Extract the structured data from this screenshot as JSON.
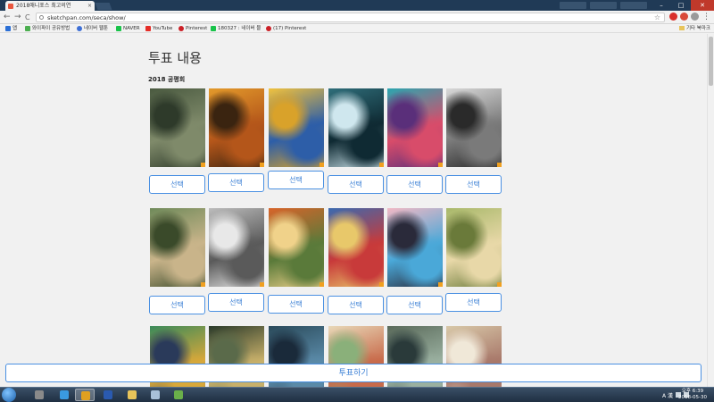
{
  "browser": {
    "tab_title": "2018애니포스 최고의연",
    "tab_close": "×",
    "url": "sketchpan.com/seca/show/",
    "nav_back": "←",
    "nav_forward": "→",
    "nav_reload": "C",
    "star": "☆",
    "menu": "⋮",
    "window_minimize": "–",
    "window_maximize": "□",
    "window_close": "✕"
  },
  "bookmarks": [
    {
      "label": "앱",
      "color": "#2b6fd6"
    },
    {
      "label": "와이파이 공유방법",
      "color": "#4caf50"
    },
    {
      "label": "네이버 웹툰",
      "color": "#3d6fd6"
    },
    {
      "label": "NAVER",
      "color": "#19c34a"
    },
    {
      "label": "YouTube",
      "color": "#e52d27"
    },
    {
      "label": "Pinterest",
      "color": "#cb2027"
    },
    {
      "label": "180327 : 네이버 블",
      "color": "#19c34a"
    },
    {
      "label": "(17) Pinterest",
      "color": "#cb2027"
    }
  ],
  "bookmarks_other": "기타 북마크",
  "page": {
    "title": "투표 내용",
    "subtitle": "2018 공평회",
    "select_label": "선택",
    "vote_button": "투표하기"
  },
  "artworks": [
    {
      "name": "artwork-1",
      "colors": [
        "#4a5a40",
        "#7f8a6a",
        "#2e3a2a"
      ]
    },
    {
      "name": "artwork-2",
      "colors": [
        "#e39a2b",
        "#b4561a",
        "#3a2410"
      ]
    },
    {
      "name": "artwork-3",
      "colors": [
        "#f2c23c",
        "#2d5ea8",
        "#d9a22a"
      ]
    },
    {
      "name": "artwork-4",
      "colors": [
        "#2f6e7a",
        "#0f2a33",
        "#cfe7ee"
      ]
    },
    {
      "name": "artwork-5",
      "colors": [
        "#2aa6b0",
        "#d84c6a",
        "#5a2f7a"
      ]
    },
    {
      "name": "artwork-6",
      "colors": [
        "#d8d8d8",
        "#7a7a7a",
        "#2a2a2a"
      ]
    },
    {
      "name": "artwork-7",
      "colors": [
        "#6f8a5a",
        "#c9b48a",
        "#3a4a2a"
      ]
    },
    {
      "name": "artwork-8",
      "colors": [
        "#bcbcbc",
        "#5a5a5a",
        "#e8e8e8"
      ]
    },
    {
      "name": "artwork-9",
      "colors": [
        "#d8642a",
        "#5a7a3a",
        "#f0d28a"
      ]
    },
    {
      "name": "artwork-10",
      "colors": [
        "#3a6ab0",
        "#c83a3a",
        "#e8c86a"
      ]
    },
    {
      "name": "artwork-11",
      "colors": [
        "#f2b8c4",
        "#4aa8d8",
        "#2a2a3a"
      ]
    },
    {
      "name": "artwork-12",
      "colors": [
        "#a8b86a",
        "#e8d8a8",
        "#6a7a3a"
      ]
    },
    {
      "name": "artwork-13",
      "colors": [
        "#3a8a5a",
        "#d8a83a",
        "#2a3a5a"
      ]
    },
    {
      "name": "artwork-14",
      "colors": [
        "#2a3a2a",
        "#c8b06a",
        "#5a6a4a"
      ]
    },
    {
      "name": "artwork-15",
      "colors": [
        "#2a4a5a",
        "#5a8aa8",
        "#1a2a3a"
      ]
    },
    {
      "name": "artwork-16",
      "colors": [
        "#e8d8b8",
        "#c86a4a",
        "#8ab07a"
      ]
    },
    {
      "name": "artwork-17",
      "colors": [
        "#5a6a5a",
        "#9ab0a0",
        "#2a3a3a"
      ]
    },
    {
      "name": "artwork-18",
      "colors": [
        "#d8c8a8",
        "#a8786a",
        "#f0e8d8"
      ]
    }
  ],
  "taskbar": {
    "apps": [
      {
        "name": "taskbar-app-1",
        "color": "#8a8a8a",
        "active": false
      },
      {
        "name": "taskbar-ie",
        "color": "#3a9ae0",
        "active": false
      },
      {
        "name": "taskbar-chrome",
        "color": "#e0a020",
        "active": true
      },
      {
        "name": "taskbar-photoshop",
        "color": "#2a5ab0",
        "active": false
      },
      {
        "name": "taskbar-explorer",
        "color": "#e8c45a",
        "active": false
      },
      {
        "name": "taskbar-app-6",
        "color": "#a8c0d8",
        "active": false
      },
      {
        "name": "taskbar-app-7",
        "color": "#6ab04a",
        "active": false
      }
    ],
    "ime_mode": "A 漢",
    "time": "오후 6:39",
    "date": "2018-05-30"
  }
}
